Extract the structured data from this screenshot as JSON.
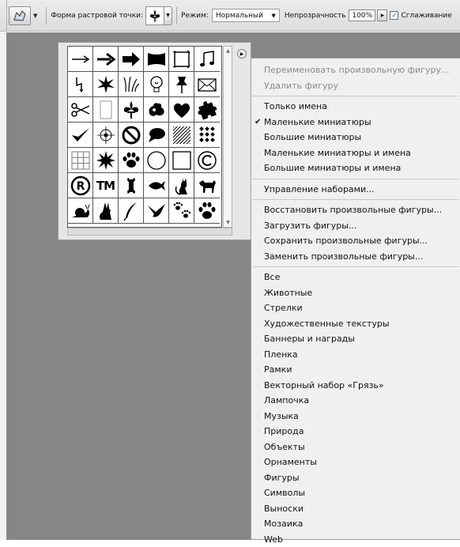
{
  "options_bar": {
    "shape_label": "Форма растровой точки:",
    "mode_label": "Режим:",
    "mode_value": "Нормальный",
    "opacity_label": "Непрозрачность",
    "opacity_value": "100%",
    "antialias_label": "Сглаживание",
    "antialias_checked": true
  },
  "picker": {
    "shapes": [
      "arrow-thin-icon",
      "arrow-icon",
      "arrow-bold-icon",
      "banner-icon",
      "frame-icon",
      "music-notes-icon",
      "lightning-icon",
      "starburst-icon",
      "grass-icon",
      "lightbulb-icon",
      "pushpin-icon",
      "envelope-icon",
      "scissors-icon",
      "blank-page-icon",
      "fleur-de-lis-icon",
      "puzzle-icon",
      "heart-icon",
      "puzzle-piece-icon",
      "checkmark-icon",
      "target-icon",
      "no-sign-icon",
      "speech-bubble-icon",
      "hatched-square-icon",
      "diamond-grid-icon",
      "grid-icon",
      "starburst-solid-icon",
      "paw-icon",
      "circle-icon",
      "square-icon",
      "copyright-icon",
      "registered-icon",
      "trademark-icon",
      "bone-icon",
      "fish-icon",
      "cat-icon",
      "dog-icon",
      "snail-icon",
      "rabbit-icon",
      "feather-icon",
      "bird-icon",
      "paw-prints-icon",
      "paw-prints-large-icon"
    ],
    "trademark_text": "TM"
  },
  "menu": {
    "groups": [
      [
        {
          "label": "Переименовать произвольную фигуру...",
          "disabled": true
        },
        {
          "label": "Удалить фигуру",
          "disabled": true
        }
      ],
      [
        {
          "label": "Только имена"
        },
        {
          "label": "Маленькие миниатюры",
          "checked": true
        },
        {
          "label": "Большие миниатюры"
        },
        {
          "label": "Маленькие миниатюры и имена"
        },
        {
          "label": "Большие миниатюры и имена"
        }
      ],
      [
        {
          "label": "Управление наборами..."
        }
      ],
      [
        {
          "label": "Восстановить произвольные фигуры..."
        },
        {
          "label": "Загрузить фигуры..."
        },
        {
          "label": "Сохранить произвольные фигуры..."
        },
        {
          "label": "Заменить произвольные фигуры..."
        }
      ],
      [
        {
          "label": "Все"
        },
        {
          "label": "Животные"
        },
        {
          "label": "Стрелки"
        },
        {
          "label": "Художественные текстуры"
        },
        {
          "label": "Баннеры и награды"
        },
        {
          "label": "Пленка"
        },
        {
          "label": "Рамки"
        },
        {
          "label": "Векторный набор «Грязь»"
        },
        {
          "label": "Лампочка"
        },
        {
          "label": "Музыка"
        },
        {
          "label": "Природа"
        },
        {
          "label": "Объекты"
        },
        {
          "label": "Орнаменты"
        },
        {
          "label": "Фигуры"
        },
        {
          "label": "Символы"
        },
        {
          "label": "Выноски"
        },
        {
          "label": "Мозаика"
        },
        {
          "label": "Web"
        }
      ]
    ]
  },
  "colors": {
    "canvas_bg": "#868686",
    "menu_bg": "#f0f0f0",
    "disabled_text": "#8a8a8a"
  }
}
